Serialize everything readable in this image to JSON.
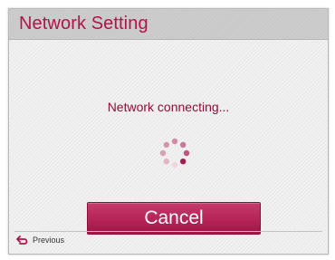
{
  "dialog": {
    "title": "Network Setting",
    "message": "Network connecting...",
    "spinner_icon": "loading-spinner-icon",
    "cancel_label": "Cancel",
    "previous_icon": "back-arrow-icon",
    "previous_label": "Previous"
  },
  "colors": {
    "accent": "#b3124a",
    "button_top": "#c63a6c",
    "button_bottom": "#a61346"
  }
}
